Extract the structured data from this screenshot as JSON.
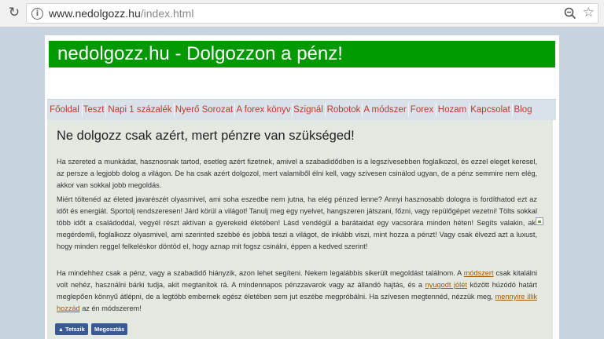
{
  "browser": {
    "url_host": "www.nedolgozz.hu",
    "url_path": "/index.html"
  },
  "site": {
    "banner_title": "nedolgozz.hu - Dolgozzon a pénz!"
  },
  "nav": {
    "items": [
      {
        "label": "Főoldal"
      },
      {
        "label": "Teszt"
      },
      {
        "label": "Napi 1 százalék"
      },
      {
        "label": "Nyerő Sorozat"
      },
      {
        "label": "A forex könyv"
      },
      {
        "label": "Szignál"
      },
      {
        "label": "Robotok"
      },
      {
        "label": "A módszer"
      },
      {
        "label": "Forex"
      },
      {
        "label": "Hozam"
      },
      {
        "label": "Kapcsolat"
      },
      {
        "label": "Blog"
      }
    ]
  },
  "main": {
    "heading": "Ne dolgozz csak azért, mert pénzre van szükséged!",
    "paragraph1": "Ha szereted a munkádat, hasznosnak tartod, esetleg azért fizetnek, amivel a szabadidődben is a legszívesebben foglalkozol, és ezzel eleget keresel, az persze a legjobb dolog a világon. De ha csak azért dolgozol, mert valamiből élni kell, vagy szívesen csinálod ugyan, de a pénz semmire nem elég, akkor van sokkal jobb megoldás.",
    "paragraph2": "Miért töltenéd az életed javarészét olyasmivel, ami soha eszedbe nem jutna, ha elég pénzed lenne? Annyi hasznosabb dologra is fordíthatod ezt az időt és energiát. Sportolj rendszeresen! Járd körül a világot! Tanulj meg egy nyelvet, hangszeren játszani, főzni, vagy repülőgépet vezetni! Tölts sokkal több időt a családoddal, vegyél részt aktívan a gyerekeid életében! Lásd vendégül a barátaidat egy vacsorára minden héten! Segíts valakin, aki megérdemli, foglalkozz olyasmivel, ami szerinted szebbé és jobbá teszi a világot, de inkább viszi, mint hozza a pénzt! Vagy csak élvezd azt a luxust, hogy minden reggel felkeléskor döntöd el, hogy aznap mit fogsz csinálni, éppen a kedved szerint!",
    "paragraph3": {
      "part1": "Ha mindehhez csak a pénz, vagy a szabadidő hiányzik, azon lehet segíteni. Nekem legalábbis sikerült megoldást találnom. A ",
      "link1": "módszert",
      "part2": " csak kitalálni volt nehéz, használni bárki tudja, akit megtanítok rá. A mindennapos pénzzavarok vagy az állandó hajtás, és a ",
      "link2": "nyugodt jólét",
      "part3": " között húzódó határt meglepően könnyű átlépni, de a legtöbb embernek egész életében sem jut eszébe megpróbálni. Ha szívesen megtennéd, nézzük meg, ",
      "link3": "mennyire illik hozzád",
      "part4": " az én módszerem!"
    },
    "share": {
      "like_label": "Tetszik",
      "share_label": "Megosztás"
    }
  },
  "icons": {
    "reload": "reload-icon",
    "info": "info-icon",
    "zoom": "zoom-icon",
    "star": "star-icon",
    "broken_image": "broken-image-icon"
  },
  "colors": {
    "banner_bg": "#009900",
    "nav_link": "#c0392b",
    "content_bg": "#e3e8e1",
    "facebook": "#3b5998"
  }
}
